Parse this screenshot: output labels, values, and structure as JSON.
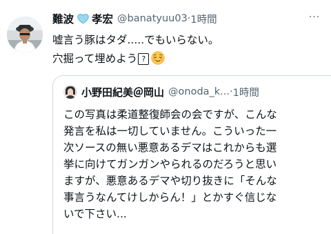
{
  "tweet": {
    "author_name_part1": "難波",
    "author_name_part2": "孝宏",
    "handle": "@banatyuu03",
    "dot": "·",
    "time": "1時間",
    "more": "···",
    "text_lines": [
      "嘘言う豚はタダ.....でもいらない。",
      "穴掘って埋めよう"
    ],
    "box_question": "?",
    "emoji": "relieved-face-icon"
  },
  "quote": {
    "author_name": "小野田紀美＠岡山",
    "handle": "@onoda_k...",
    "dot": "·",
    "time": "1時間",
    "text_lines": [
      "この写真は柔道整復師会の会ですが、こんな",
      "発言を私は一切していません。こういった一",
      "次ソースの無い悪意あるデマはこれからも選",
      "挙に向けてガンガンやられるのだろうと思い",
      "ますが、悪意あるデマや切り抜きに「そんな",
      "事言うなんてけしからん！」とかすぐ信じな",
      "いで下さい..."
    ]
  },
  "colors": {
    "text": "#0f1419",
    "secondary": "#536471",
    "border": "#cfd9de",
    "heart": "#9ad8f0"
  }
}
